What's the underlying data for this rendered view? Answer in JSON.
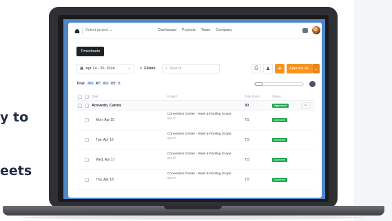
{
  "side_text": {
    "line1": "y to",
    "line2": "eets"
  },
  "nav": {
    "project_select": "Select project",
    "links": [
      "Dashboard",
      "Projects",
      "Team",
      "Company"
    ]
  },
  "tooltip": "Timesheets",
  "toolbar": {
    "date_range": "Apr 14 - 20, 2024",
    "filters_label": "Filters",
    "search_placeholder": "Search...",
    "add_label": "+",
    "approve_label": "Approve all"
  },
  "totals": {
    "total_label": "Total:",
    "total_value": "860",
    "rt_label": "RT:",
    "rt_value": "852",
    "ot_label": "OT:",
    "ot_value": "8"
  },
  "table": {
    "headers": {
      "date": "Date",
      "project": "Project",
      "total_hours": "Total hours",
      "status": "Status"
    },
    "group": {
      "name": "Acevedo, Carlos",
      "hours": "30",
      "status": "Approved",
      "more": "···"
    },
    "rows": [
      {
        "date": "Mon, Apr 15",
        "project": "Convention Center - Steel & Roofing Scope",
        "code": "89137",
        "hours": "7.5",
        "status": "Approved"
      },
      {
        "date": "Tue, Apr 16",
        "project": "Convention Center - Steel & Roofing Scope",
        "code": "89137",
        "hours": "7.5",
        "status": "Approved"
      },
      {
        "date": "Wed, Apr 17",
        "project": "Convention Center - Steel & Roofing Scope",
        "code": "89137",
        "hours": "7.5",
        "status": "Approved"
      },
      {
        "date": "Thu, Apr 18",
        "project": "Convention Center - Steel & Roofing Scope",
        "code": "89137",
        "hours": "7.5",
        "status": "Approved"
      }
    ]
  },
  "colors": {
    "accent": "#f7931e",
    "approved": "#1ea84f",
    "screen": "#4f87c9",
    "link": "#2f7bd9"
  }
}
